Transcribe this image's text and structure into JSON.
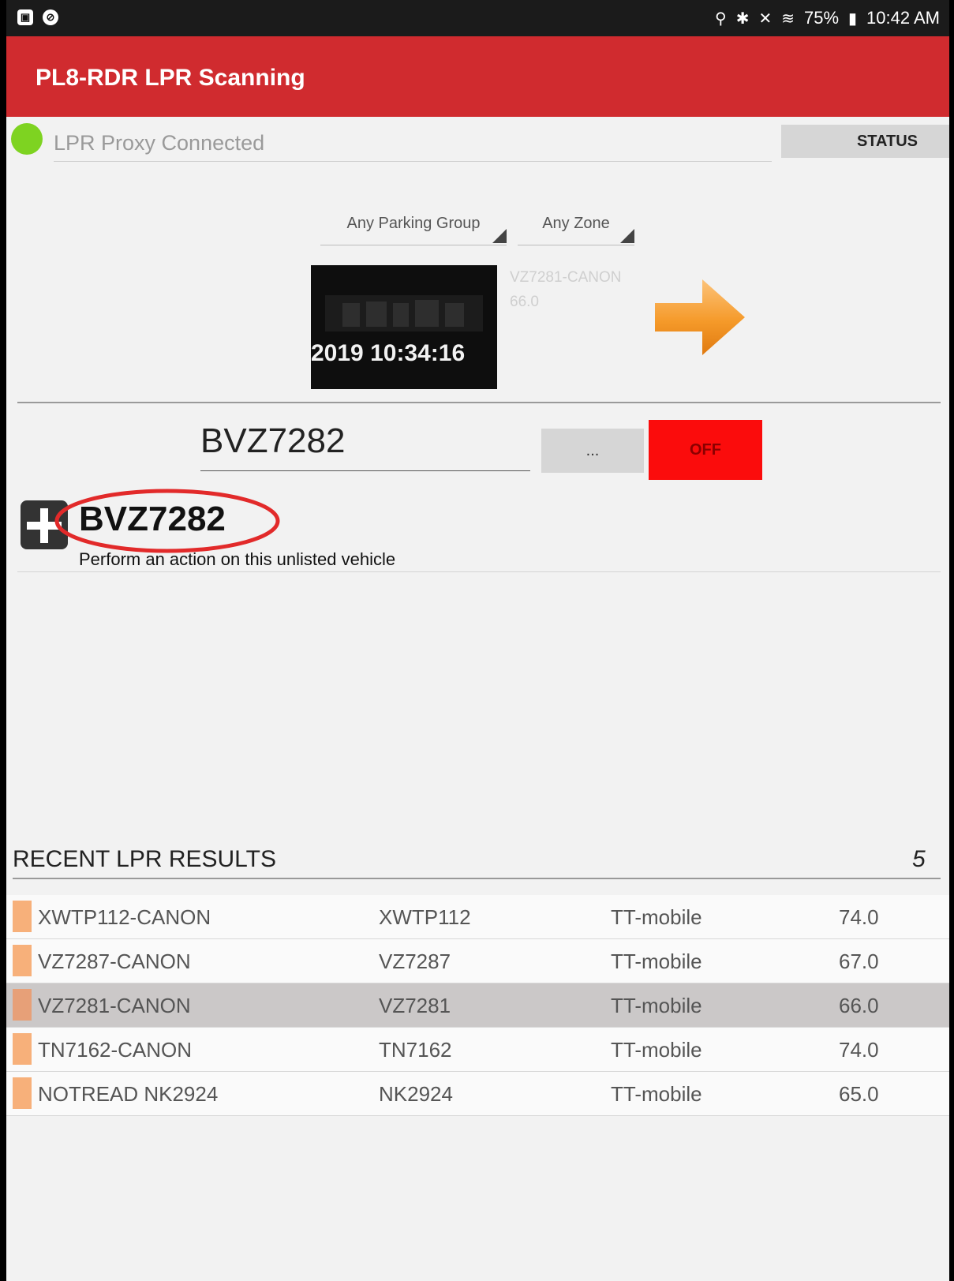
{
  "status_bar": {
    "time": "10:42 AM",
    "battery": "75%"
  },
  "app_bar": {
    "title": "PL8-RDR LPR Scanning"
  },
  "connection": {
    "text": "LPR Proxy Connected",
    "status_button": "STATUS",
    "color": "#7ed321"
  },
  "filters": {
    "parking_group": "Any Parking Group",
    "zone": "Any Zone"
  },
  "last_capture": {
    "timestamp": "2019 10:34:16",
    "camera_name": "VZ7281-CANON",
    "score": "66.0"
  },
  "plate_entry": {
    "value": "BVZ7282",
    "more_label": "...",
    "toggle_label": "OFF"
  },
  "unlisted": {
    "plate": "BVZ7282",
    "description": "Perform an action on this unlisted vehicle"
  },
  "recent": {
    "title": "RECENT LPR RESULTS",
    "count": "5",
    "rows": [
      {
        "name": "XWTP112-CANON",
        "plate": "XWTP112",
        "source": "TT-mobile",
        "score": "74.0"
      },
      {
        "name": "VZ7287-CANON",
        "plate": "VZ7287",
        "source": "TT-mobile",
        "score": "67.0"
      },
      {
        "name": "VZ7281-CANON",
        "plate": "VZ7281",
        "source": "TT-mobile",
        "score": "66.0",
        "selected": true
      },
      {
        "name": "TN7162-CANON",
        "plate": "TN7162",
        "source": "TT-mobile",
        "score": "74.0"
      },
      {
        "name": "NOTREAD NK2924",
        "plate": "NK2924",
        "source": "TT-mobile",
        "score": "65.0"
      }
    ]
  },
  "colors": {
    "app_bar": "#d02b2f",
    "off_button": "#fb0c0c",
    "result_swatch": "#f7b07a"
  }
}
